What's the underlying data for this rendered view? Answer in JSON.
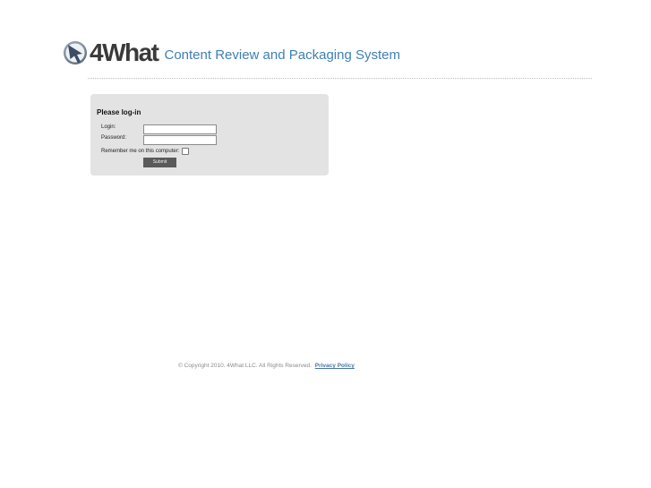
{
  "header": {
    "logo_text": "4What",
    "logo_icon": "cursor-arrow-circle-icon",
    "site_title": "Content Review and Packaging System"
  },
  "login": {
    "heading": "Please log-in",
    "login_label": "Login:",
    "login_value": "",
    "password_label": "Password:",
    "password_value": "",
    "remember_label": "Remember me on this computer:",
    "remember_checked": false,
    "submit_label": "Submit"
  },
  "footer": {
    "copyright": "© Copyright 2010. 4What LLC. All Rights Reserved.",
    "privacy_link": "Privacy Policy"
  },
  "colors": {
    "title_blue": "#3f7fb5",
    "login_box_bg": "#e3e3e3",
    "button_bg": "#5a5a5a",
    "link_blue": "#4a76a8"
  }
}
